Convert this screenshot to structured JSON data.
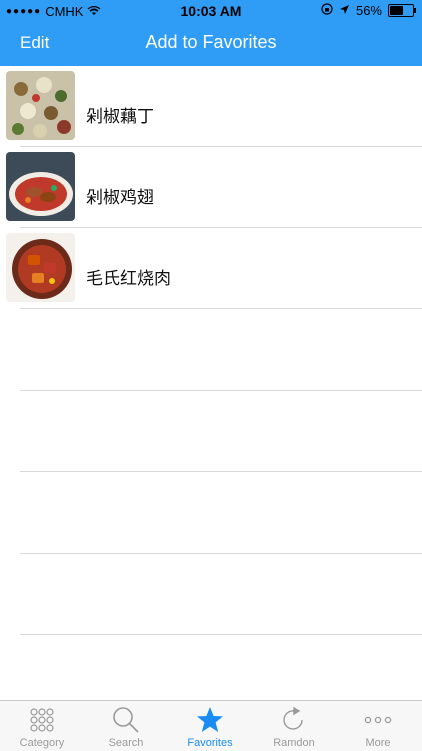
{
  "status_bar": {
    "carrier": "CMHK",
    "time": "10:03 AM",
    "battery": "56%"
  },
  "nav": {
    "edit_label": "Edit",
    "title": "Add to Favorites"
  },
  "favorites": [
    {
      "name": "剁椒藕丁"
    },
    {
      "name": "剁椒鸡翅"
    },
    {
      "name": "毛氏红烧肉"
    }
  ],
  "tabs": [
    {
      "label": "Category",
      "icon": "grid-icon"
    },
    {
      "label": "Search",
      "icon": "search-icon"
    },
    {
      "label": "Favorites",
      "icon": "star-icon"
    },
    {
      "label": "Ramdon",
      "icon": "refresh-icon"
    },
    {
      "label": "More",
      "icon": "more-icon"
    }
  ],
  "colors": {
    "accent": "#2f9cf5",
    "active_tab": "#1a8cf5",
    "inactive_tab": "#9a9a9a"
  }
}
